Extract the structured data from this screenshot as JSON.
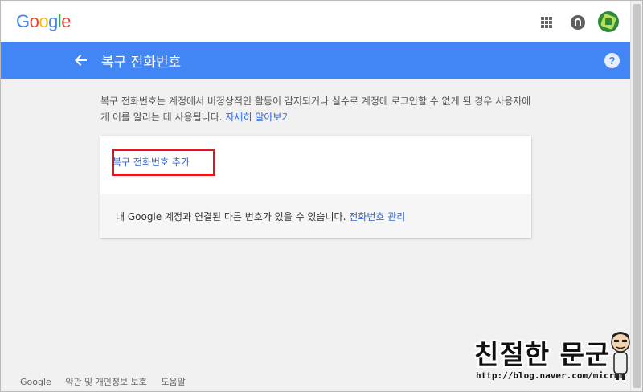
{
  "brand": {
    "logo_letters": [
      {
        "char": "G",
        "color": "#4285f4"
      },
      {
        "char": "o",
        "color": "#ea4335"
      },
      {
        "char": "o",
        "color": "#fbbc05"
      },
      {
        "char": "g",
        "color": "#4285f4"
      },
      {
        "char": "l",
        "color": "#34a853"
      },
      {
        "char": "e",
        "color": "#ea4335"
      }
    ]
  },
  "topbar": {
    "apps_icon": "apps-grid-icon",
    "notifications_icon": "notifications-icon",
    "avatar_icon": "account-avatar"
  },
  "header": {
    "title": "복구 전화번호",
    "back_icon": "arrow-back-icon",
    "help_icon_glyph": "?",
    "accent_color": "#4285f4"
  },
  "main": {
    "description_text": "복구 전화번호는 계정에서 비정상적인 활동이 감지되거나 실수로 계정에 로그인할 수 없게 된 경우 사용자에게 이를 알리는 데 사용됩니다.",
    "learn_more_link": "자세히 알아보기",
    "card": {
      "add_phone_link": "복구 전화번호 추가",
      "note_text": "내 Google 계정과 연결된 다른 번호가 있을 수 있습니다.",
      "manage_link": "전화번호 관리"
    }
  },
  "footer": {
    "items": [
      "Google",
      "약관 및 개인정보 보호",
      "도움말"
    ]
  },
  "watermark": {
    "title": "친절한 문군",
    "url": "http://blog.naver.com/micrmm"
  }
}
